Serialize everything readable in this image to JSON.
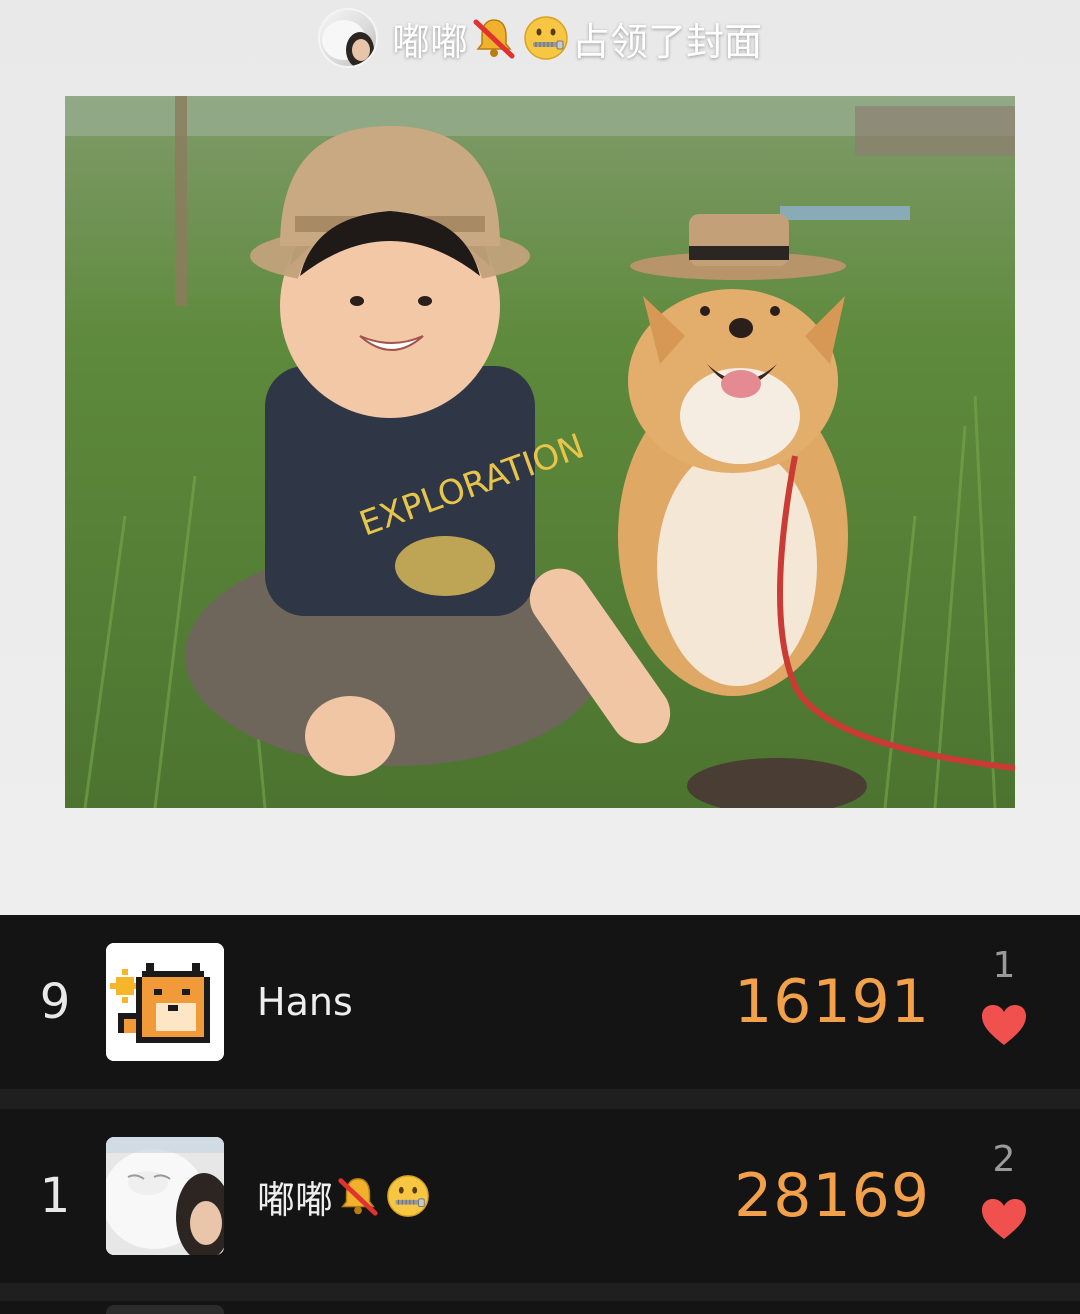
{
  "cover": {
    "occupier_name": "嘟嘟",
    "occupied_text": "占领了封面",
    "photo_description_icon": "cover-photo",
    "emoji_icons": [
      "muted-bell-icon",
      "zipper-mouth-face-icon"
    ]
  },
  "leaderboard": {
    "rows": [
      {
        "rank": "9",
        "name": "Hans",
        "steps": "16191",
        "likes": "1",
        "avatar_icon": "pixel-shiba-sun-avatar"
      },
      {
        "rank": "1",
        "name": "嘟嘟",
        "steps": "28169",
        "likes": "2",
        "avatar_icon": "white-cat-girl-avatar",
        "name_icons": [
          "muted-bell-icon",
          "zipper-mouth-face-icon"
        ]
      }
    ]
  },
  "colors": {
    "steps": "#f3a04a",
    "heart": "#f0514f",
    "row_bg": "#141414",
    "board_bg": "#1f1f1f"
  }
}
